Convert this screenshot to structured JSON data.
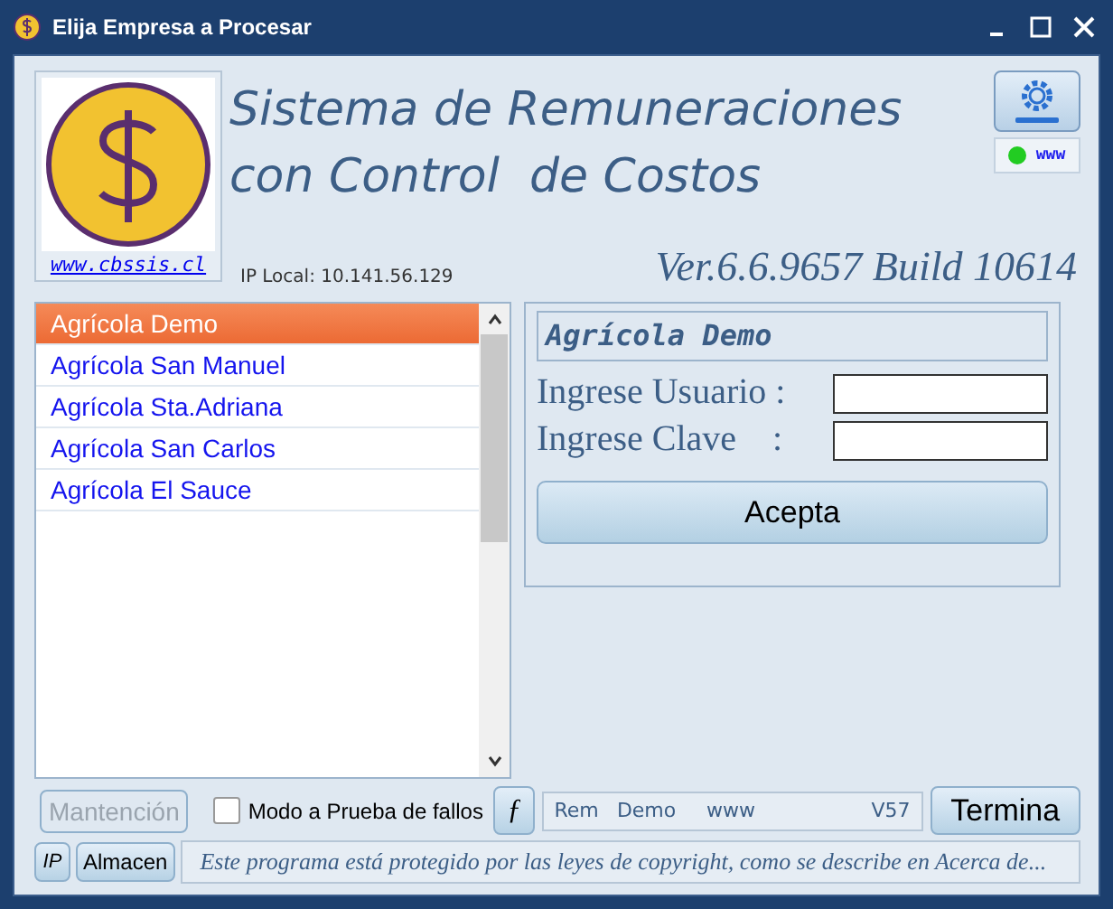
{
  "window": {
    "title": "Elija Empresa a Procesar"
  },
  "header": {
    "link": "www.cbssis.cl",
    "title_line_1": "Sistema de Remuneraciones",
    "title_line_2": "con Control  de Costos",
    "ip_local": "IP Local: 10.141.56.129",
    "version": "Ver.6.6.9657 Build 10614",
    "web_status": {
      "label": "www",
      "on": true
    }
  },
  "companies": [
    {
      "name": "Agrícola Demo",
      "selected": true
    },
    {
      "name": "Agrícola San Manuel",
      "selected": false
    },
    {
      "name": "Agrícola Sta.Adriana",
      "selected": false
    },
    {
      "name": "Agrícola San Carlos",
      "selected": false
    },
    {
      "name": "Agrícola El Sauce",
      "selected": false
    }
  ],
  "login": {
    "company": "Agrícola Demo",
    "user_label": "Ingrese Usuario :",
    "password_label": "Ingrese Clave    :",
    "accept": "Acepta"
  },
  "bottom": {
    "maintenance": {
      "label": "Mantención",
      "disabled": true
    },
    "failsafe": {
      "label": "Modo a Prueba de fallos",
      "checked": false
    },
    "function_key": "ƒ",
    "status": [
      "Rem",
      "Demo",
      "www",
      "V57"
    ],
    "exit": "Termina",
    "ip_button": "IP",
    "store_button": "Almacen",
    "copyright": "Este programa está protegido por las leyes de copyright, como se describe en Acerca de..."
  }
}
